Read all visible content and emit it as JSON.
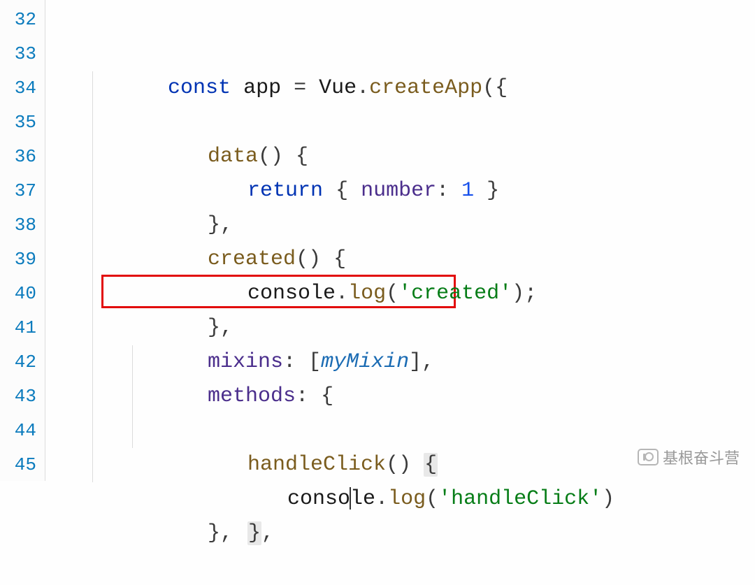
{
  "gutter": {
    "lines": [
      "32",
      "33",
      "34",
      "35",
      "36",
      "37",
      "38",
      "39",
      "40",
      "41",
      "42",
      "43",
      "44",
      "45"
    ]
  },
  "code": {
    "l33": {
      "kw_const": "const",
      "app": "app",
      "eq": " = ",
      "vue": "Vue",
      "dot": ".",
      "create": "createApp",
      "open": "({"
    },
    "l34": {
      "data": "data",
      "parens": "() {"
    },
    "l35": {
      "ret": "return",
      "sp": " { ",
      "number": "number",
      "colon": ": ",
      "one": "1",
      "close": " }"
    },
    "l36": {
      "txt": "},"
    },
    "l37": {
      "created": "created",
      "parens": "() {"
    },
    "l38": {
      "console": "console",
      "dot": ".",
      "log": "log",
      "open": "(",
      "str": "'created'",
      "close": ");"
    },
    "l39": {
      "txt": "},"
    },
    "l40": {
      "mixins": "mixins",
      "colon": ": [",
      "myMixin": "myMixin",
      "close": "],"
    },
    "l41": {
      "methods": "methods",
      "colon": ": {"
    },
    "l42": {
      "handle": "handleClick",
      "parens": "() ",
      "brace": "{"
    },
    "l43": {
      "conso": "conso",
      "le": "le",
      "dot": ".",
      "log": "log",
      "open": "(",
      "str": "'handleClick'",
      "close": ")"
    },
    "l44": {
      "txt": "},"
    },
    "l45": {
      "txt": "},"
    }
  },
  "watermark": {
    "text": "基根奋斗营"
  }
}
